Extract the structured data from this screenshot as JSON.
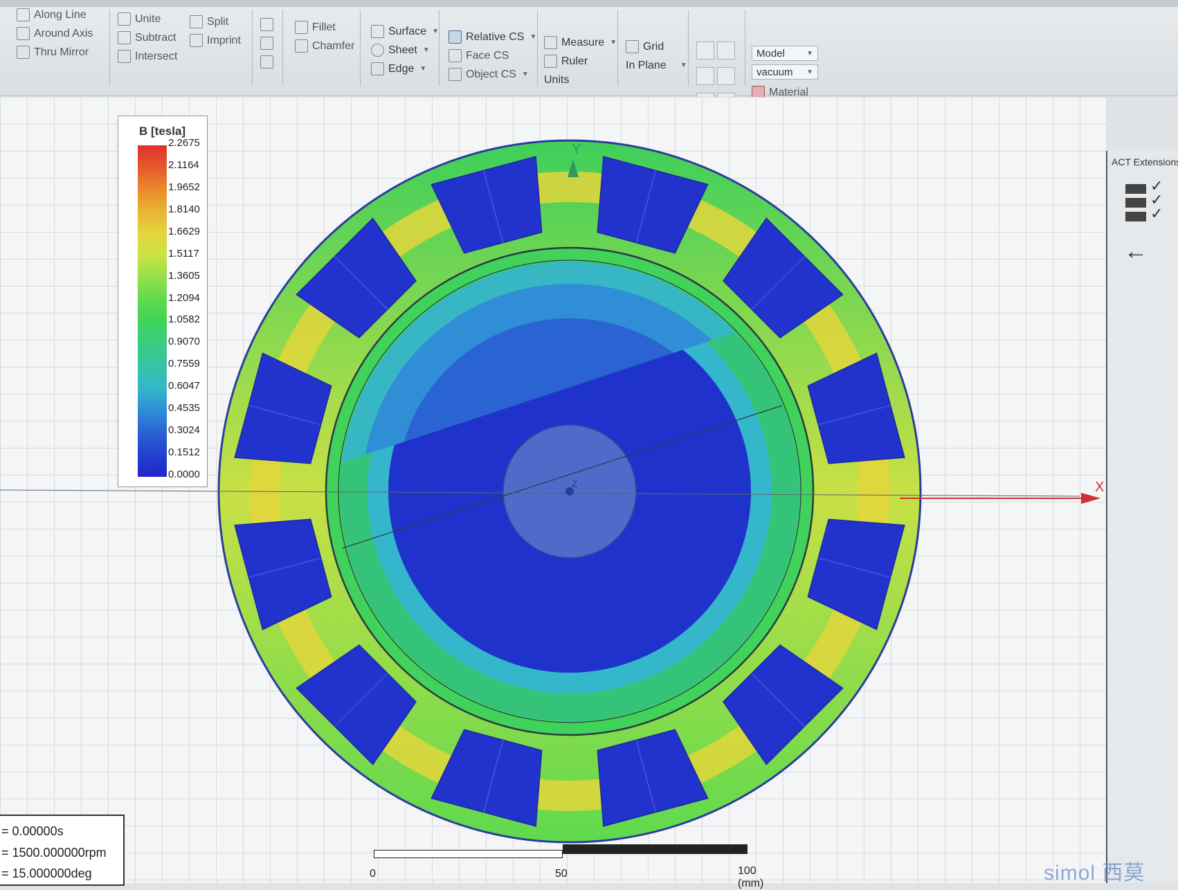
{
  "ribbon": {
    "along_line": "Along Line",
    "around_axis": "Around Axis",
    "thru_mirror": "Thru Mirror",
    "unite": "Unite",
    "subtract": "Subtract",
    "intersect": "Intersect",
    "split": "Split",
    "imprint": "Imprint",
    "fillet": "Fillet",
    "chamfer": "Chamfer",
    "surface": "Surface",
    "sheet": "Sheet",
    "edge": "Edge",
    "relative_cs": "Relative CS",
    "face_cs": "Face CS",
    "object_cs": "Object CS",
    "measure": "Measure",
    "ruler": "Ruler",
    "units": "Units",
    "grid": "Grid",
    "grid_plane": "In Plane",
    "model": "Model",
    "material_value": "vacuum",
    "material": "Material"
  },
  "legend": {
    "title": "B [tesla]",
    "values": [
      "2.2675",
      "2.1164",
      "1.9652",
      "1.8140",
      "1.6629",
      "1.5117",
      "1.3605",
      "1.2094",
      "1.0582",
      "0.9070",
      "0.7559",
      "0.6047",
      "0.4535",
      "0.3024",
      "0.1512",
      "0.0000"
    ],
    "colors": [
      "#e0302e",
      "#e35a2c",
      "#ea8a2b",
      "#e9b534",
      "#e3d63c",
      "#c9e344",
      "#92e04a",
      "#5fd94e",
      "#3fd35a",
      "#3acb82",
      "#37c3a8",
      "#34b7cb",
      "#2f8ed6",
      "#2a63d2",
      "#2340cf",
      "#1f28c8"
    ]
  },
  "axes": {
    "x": "X",
    "y": "Y",
    "z": "Z"
  },
  "timebox": {
    "time": "= 0.00000s",
    "speed": "= 1500.000000rpm",
    "position": "= 15.000000deg"
  },
  "scale": {
    "zero": "0",
    "mid": "50",
    "end": "100 (mm)"
  },
  "right_panel": {
    "title": "ACT Extensions"
  },
  "watermark": "simol 西莫"
}
